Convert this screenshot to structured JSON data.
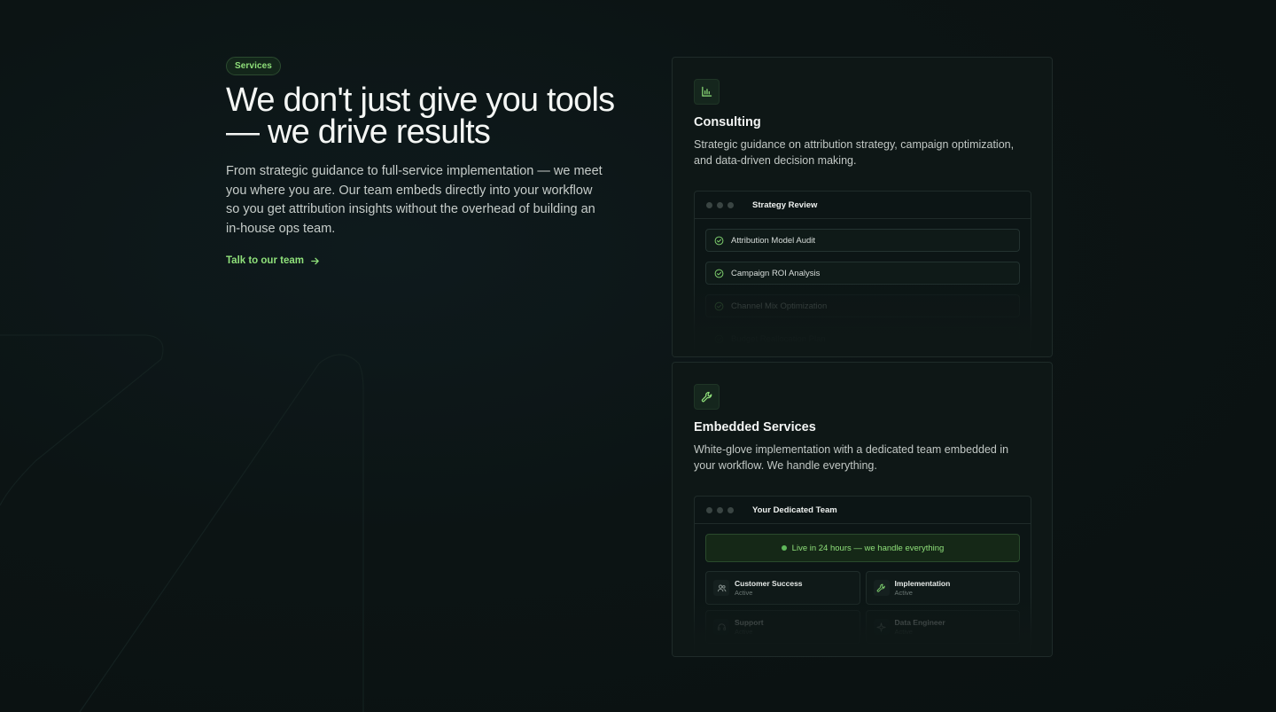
{
  "hero": {
    "badge": "Services",
    "headline": "We don't just give you tools — we drive results",
    "subtitle": "From strategic guidance to full-service implementation — we meet you where you are. Our team embeds directly into your workflow so you get attribution insights without the overhead of building an in-house ops team.",
    "cta_label": "Talk to our team",
    "cta_icon": "arrow-right-icon"
  },
  "colors": {
    "accent": "#8fe07a",
    "background": "#0c1313",
    "card": "#0e1716"
  },
  "consulting": {
    "icon": "bar-chart-icon",
    "title": "Consulting",
    "description": "Strategic guidance on attribution strategy, campaign optimization, and data-driven decision making.",
    "mock_title": "Strategy Review",
    "items": [
      {
        "label": "Attribution Model Audit"
      },
      {
        "label": "Campaign ROI Analysis"
      },
      {
        "label": "Channel Mix Optimization"
      },
      {
        "label": "Budget Reallocation Plan"
      }
    ]
  },
  "embedded": {
    "icon": "wrench-icon",
    "title": "Embedded Services",
    "description": "White-glove implementation with a dedicated team embedded in your workflow. We handle everything.",
    "mock_title": "Your Dedicated Team",
    "live_banner": "Live in 24 hours — we handle everything",
    "team": [
      {
        "name": "Customer Success",
        "status": "Active",
        "icon": "users-icon"
      },
      {
        "name": "Implementation",
        "status": "Active",
        "icon": "wrench-icon"
      },
      {
        "name": "Support",
        "status": "Active",
        "icon": "headset-icon"
      },
      {
        "name": "Data Engineer",
        "status": "Active",
        "icon": "sparkle-icon"
      }
    ]
  }
}
